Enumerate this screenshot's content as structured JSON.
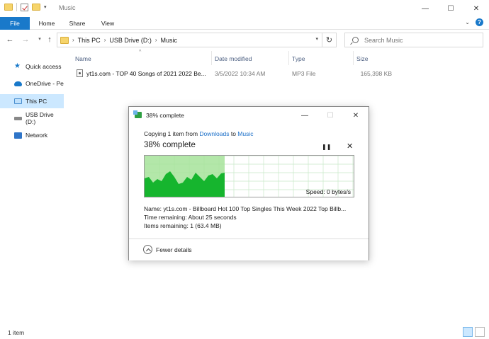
{
  "window": {
    "title": "Music",
    "minimize": "—",
    "maximize": "☐",
    "close": "✕"
  },
  "ribbon": {
    "tabs": [
      "File",
      "Home",
      "Share",
      "View"
    ],
    "help": "?",
    "collapse": "⌄"
  },
  "address": {
    "crumbs": [
      "This PC",
      "USB Drive (D:)",
      "Music"
    ],
    "search_placeholder": "Search Music"
  },
  "sidebar": {
    "items": [
      {
        "label": "Quick access",
        "icon": "star-icon"
      },
      {
        "label": "OneDrive - Pe",
        "icon": "cloud-icon"
      },
      {
        "label": "This PC",
        "icon": "computer-icon"
      },
      {
        "label": "USB Drive (D:)",
        "icon": "drive-icon"
      },
      {
        "label": "Network",
        "icon": "network-icon"
      }
    ]
  },
  "columns": {
    "name": "Name",
    "date": "Date modified",
    "type": "Type",
    "size": "Size"
  },
  "files": [
    {
      "name": "yt1s.com - TOP 40 Songs of 2021 2022  Be...",
      "date": "3/5/2022 10:34 AM",
      "type": "MP3 File",
      "size": "165,398 KB"
    }
  ],
  "status": {
    "count": "1 item"
  },
  "dialog": {
    "title": "38% complete",
    "copying_prefix": "Copying 1 item from ",
    "source": "Downloads",
    "copying_mid": " to ",
    "destination": "Music",
    "percent_label": "38% complete",
    "progress_fraction": 0.38,
    "pause": "❚❚",
    "cancel": "✕",
    "speed": "Speed: 0 bytes/s",
    "name_line": "Name:  yt1s.com - Billboard Hot 100 Top Singles This Week 2022  Top Billb...",
    "time_line": "Time remaining:  About 25 seconds",
    "items_line": "Items remaining:  1 (63.4 MB)",
    "fewer_details": "Fewer details",
    "colors": {
      "fill_light": "#a6e39a",
      "fill_dark": "#16b52e",
      "grid": "#c8e8c8"
    }
  }
}
